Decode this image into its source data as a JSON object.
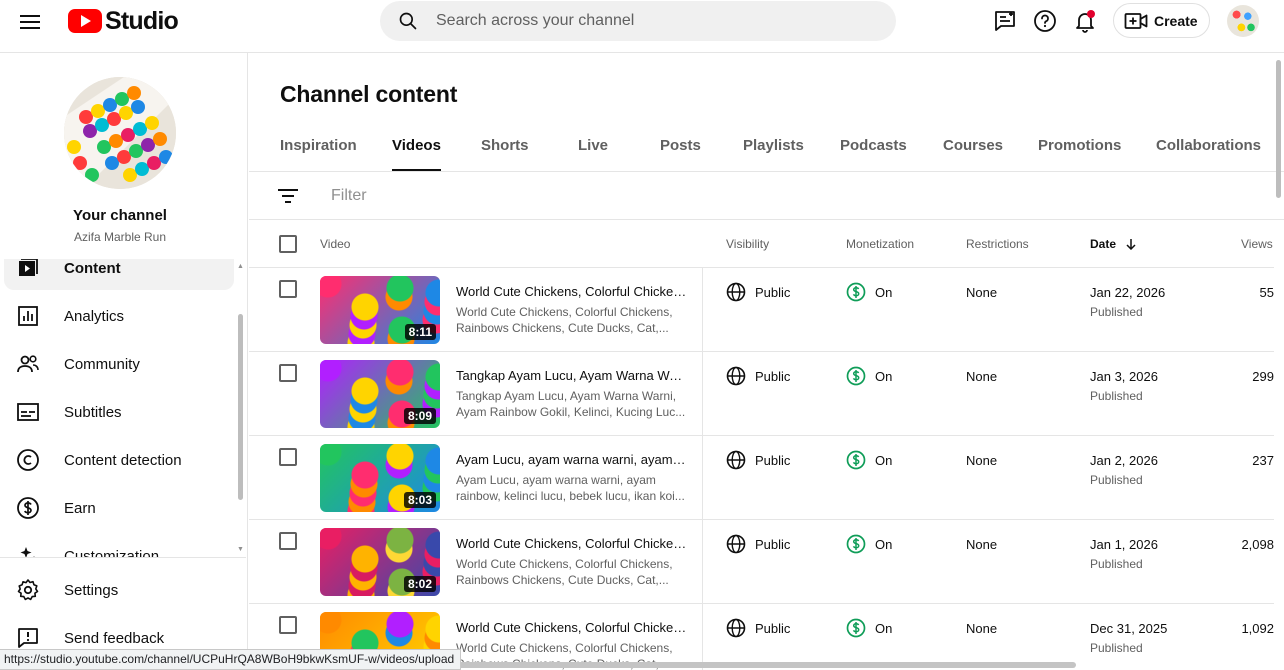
{
  "header": {
    "logo_text": "Studio",
    "search_placeholder": "Search across your channel",
    "create_label": "Create"
  },
  "sidebar": {
    "channel_title": "Your channel",
    "channel_name": "Azifa Marble Run",
    "items": [
      {
        "label": "Content",
        "icon": "content-icon",
        "active": true
      },
      {
        "label": "Analytics",
        "icon": "analytics-icon"
      },
      {
        "label": "Community",
        "icon": "community-icon"
      },
      {
        "label": "Subtitles",
        "icon": "subtitles-icon"
      },
      {
        "label": "Content detection",
        "icon": "copyright-icon"
      },
      {
        "label": "Earn",
        "icon": "earn-icon"
      },
      {
        "label": "Customization",
        "icon": "customization-icon"
      }
    ],
    "bottom": [
      {
        "label": "Settings",
        "icon": "gear-icon"
      },
      {
        "label": "Send feedback",
        "icon": "feedback-icon"
      }
    ]
  },
  "main": {
    "title": "Channel content",
    "tabs": [
      "Inspiration",
      "Videos",
      "Shorts",
      "Live",
      "Posts",
      "Playlists",
      "Podcasts",
      "Courses",
      "Promotions",
      "Collaborations"
    ],
    "active_tab": "Videos",
    "filter_placeholder": "Filter",
    "columns": {
      "video": "Video",
      "visibility": "Visibility",
      "monetization": "Monetization",
      "restrictions": "Restrictions",
      "date": "Date",
      "views": "Views"
    },
    "rows": [
      {
        "title": "World Cute Chickens, Colorful Chickens, Rainbows Chickens, Cute Ducks, Cat,...",
        "desc": "World Cute Chickens, Colorful Chickens, Rainbows Chickens, Cute Ducks, Cat,...",
        "duration": "8:11",
        "visibility": "Public",
        "monetization": "On",
        "restrictions": "None",
        "date": "Jan 22, 2026",
        "status": "Published",
        "views": "55"
      },
      {
        "title": "Tangkap Ayam Lucu, Ayam Warna Warni, Ayam Rainbow Gokil",
        "desc": "Tangkap Ayam Lucu, Ayam Warna Warni, Ayam Rainbow Gokil, Kelinci, Kucing Luc...",
        "duration": "8:09",
        "visibility": "Public",
        "monetization": "On",
        "restrictions": "None",
        "date": "Jan 3, 2026",
        "status": "Published",
        "views": "299"
      },
      {
        "title": "Ayam Lucu, ayam warna warni, ayam rainbow",
        "desc": "Ayam Lucu, ayam warna warni, ayam rainbow, kelinci lucu, bebek lucu, ikan koi...",
        "duration": "8:03",
        "visibility": "Public",
        "monetization": "On",
        "restrictions": "None",
        "date": "Jan 2, 2026",
        "status": "Published",
        "views": "237"
      },
      {
        "title": "World Cute Chickens, Colorful Chickens, Rainbows Chickens, Cute Ducks, Cat,...",
        "desc": "World Cute Chickens, Colorful Chickens, Rainbows Chickens, Cute Ducks, Cat,...",
        "duration": "8:02",
        "visibility": "Public",
        "monetization": "On",
        "restrictions": "None",
        "date": "Jan 1, 2026",
        "status": "Published",
        "views": "2,098"
      },
      {
        "title": "World Cute Chickens, Colorful Chickens, Rainbows Chickens, Cute Ducks, Cat,...",
        "desc": "World Cute Chickens, Colorful Chickens, Rainbows Chickens, Cute Ducks, Cat,...",
        "duration": "",
        "visibility": "Public",
        "monetization": "On",
        "restrictions": "None",
        "date": "Dec 31, 2025",
        "status": "Published",
        "views": "1,092"
      }
    ]
  },
  "status_bar": {
    "url": "https://studio.youtube.com/channel/UCPuHrQA8WBoH9bkwKsmUF-w/videos/upload"
  },
  "colors": {
    "brand_red": "#ff0000",
    "monetization_green": "#0f9d58",
    "notification_red": "#e1002d",
    "text_primary": "#0f0f0f",
    "text_secondary": "#606060"
  }
}
